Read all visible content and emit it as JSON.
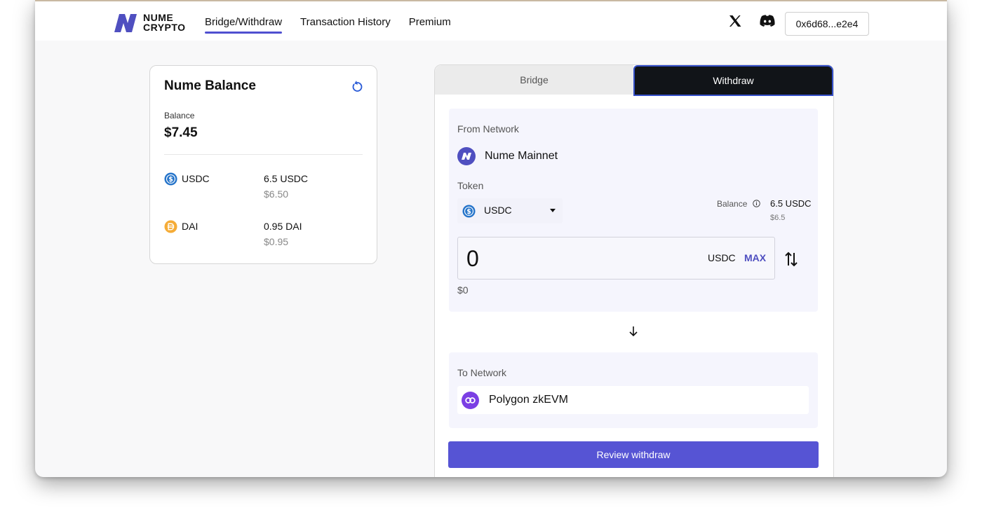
{
  "brand": {
    "line1": "NUME",
    "line2": "CRYPTO"
  },
  "nav": [
    {
      "label": "Bridge/Withdraw",
      "active": true
    },
    {
      "label": "Transaction History",
      "active": false
    },
    {
      "label": "Premium",
      "active": false
    }
  ],
  "social": {
    "x_icon": "x-icon",
    "discord_icon": "discord-icon"
  },
  "wallet": {
    "address": "0x6d68...e2e4"
  },
  "balance_card": {
    "title": "Nume Balance",
    "balance_label": "Balance",
    "total": "$7.45",
    "assets": [
      {
        "name": "USDC",
        "amount": "6.5 USDC",
        "usd": "$6.50",
        "icon": "usdc-icon",
        "color": "#2775ca"
      },
      {
        "name": "DAI",
        "amount": "0.95 DAI",
        "usd": "$0.95",
        "icon": "dai-icon",
        "color": "#f5ac37"
      }
    ]
  },
  "tabs": {
    "bridge": "Bridge",
    "withdraw": "Withdraw",
    "active": "withdraw"
  },
  "from": {
    "label": "From Network",
    "network": "Nume Mainnet",
    "token_label": "Token",
    "token": "USDC",
    "balance_label": "Balance",
    "balance_amount": "6.5 USDC",
    "balance_usd": "$6.5",
    "amount": "0",
    "amount_unit": "USDC",
    "max_label": "MAX",
    "usd_value": "$0"
  },
  "to": {
    "label": "To Network",
    "network": "Polygon zkEVM"
  },
  "action": {
    "review_label": "Review withdraw"
  },
  "colors": {
    "accent": "#5654d4",
    "nume": "#4f4fc0",
    "polygon": "#7b3fe4",
    "usdc": "#2775ca",
    "dai": "#f5ac37"
  }
}
